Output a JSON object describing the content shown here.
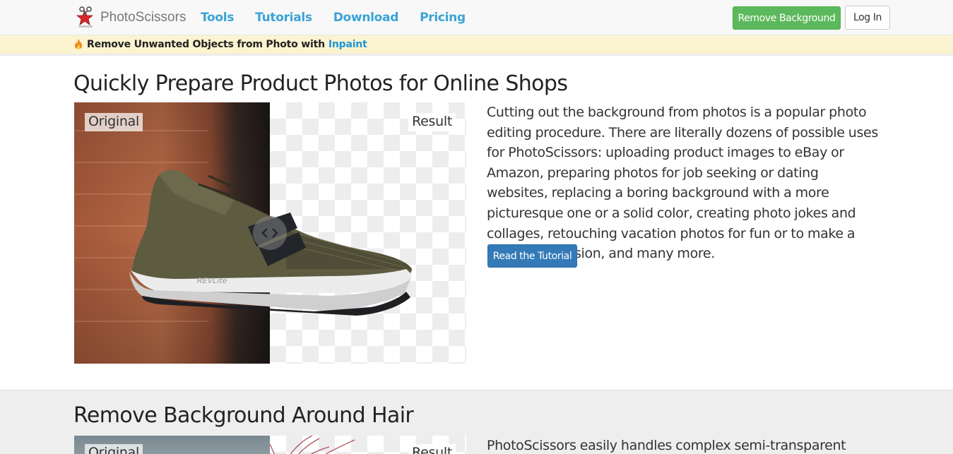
{
  "brand": {
    "name": "PhotoScissors",
    "logo_icon": "scissors-star-logo-icon"
  },
  "nav": {
    "links": [
      "Tools",
      "Tutorials",
      "Download",
      "Pricing"
    ],
    "remove_bg_label": "Remove Background",
    "login_label": "Log In"
  },
  "promo": {
    "icon": "flame-icon",
    "text": "Remove Unwanted Objects from Photo with",
    "link_text": "Inpaint"
  },
  "section1": {
    "title": "Quickly Prepare Product Photos for Online Shops",
    "label_original": "Original",
    "label_result": "Result",
    "slider_icon": "chevron-left-right-icon",
    "description": "Cutting out the background from photos is a popular photo editing procedure. There are literally dozens of possible uses for PhotoScissors: uploading product images to eBay or Amazon, preparing photos for job seeking or dating websites, replacing a boring background with a more picturesque one or a solid color, creating photo jokes and collages, retouching vacation photos for fun or to make a better impression, and many more.",
    "button_label": "Read the Tutorial",
    "shoe_text": "REVLite"
  },
  "section2": {
    "title": "Remove Background Around Hair",
    "label_original": "Original",
    "label_result": "Result",
    "description": "PhotoScissors easily handles complex semi-transparent objects"
  },
  "colors": {
    "nav_link": "#3aa3d5",
    "success": "#5cb85c",
    "primary": "#337ab7",
    "promo_bg": "#fcf3d0",
    "promo_link": "#1e96d8"
  }
}
